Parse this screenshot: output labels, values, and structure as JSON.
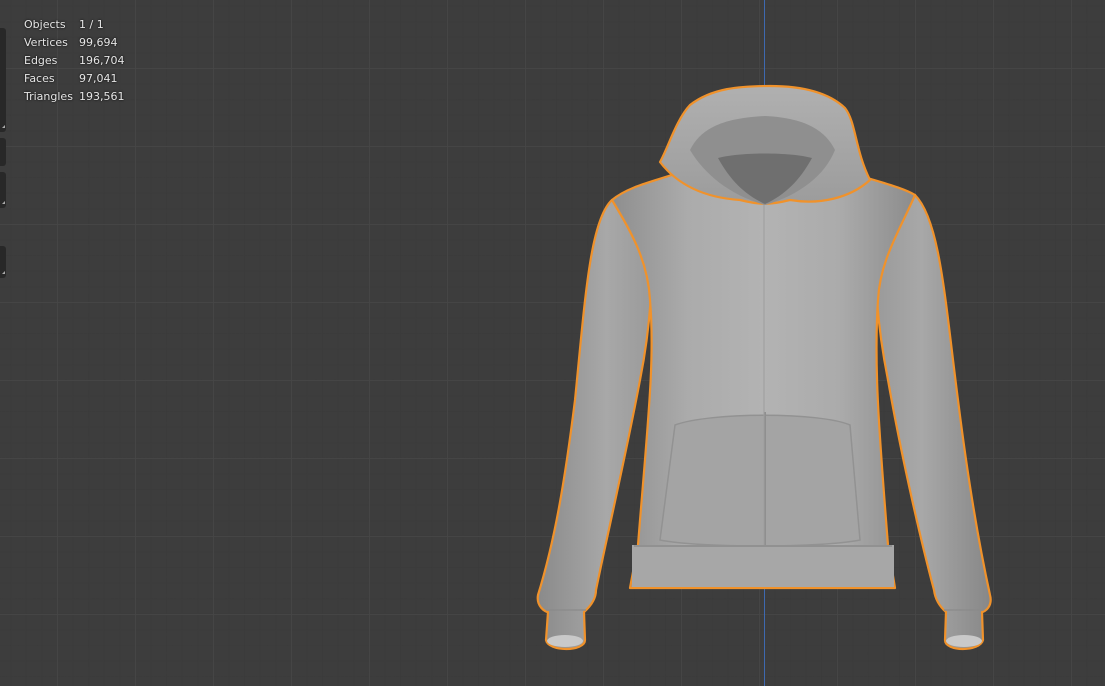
{
  "stats": {
    "rows": [
      {
        "label": "Objects",
        "value": "1 / 1"
      },
      {
        "label": "Vertices",
        "value": "99,694"
      },
      {
        "label": "Edges",
        "value": "196,704"
      },
      {
        "label": "Faces",
        "value": "97,041"
      },
      {
        "label": "Triangles",
        "value": "193,561"
      }
    ]
  },
  "colors": {
    "background": "#3d3d3d",
    "selection_outline": "#f0922b",
    "axis_z": "#3e69b0",
    "mesh": "#a6a6a6"
  }
}
